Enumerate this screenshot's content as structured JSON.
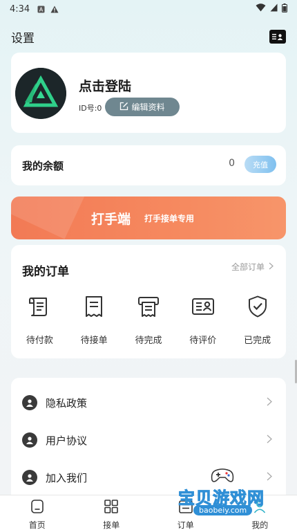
{
  "status_bar": {
    "time": "4:34"
  },
  "header": {
    "title": "设置",
    "icon": "contact-card-icon"
  },
  "profile": {
    "login_title": "点击登陆",
    "id_label": "ID号:0",
    "edit_label": "编辑资料"
  },
  "balance": {
    "label": "我的余额",
    "value": "0",
    "recharge_label": "充值"
  },
  "banner": {
    "title": "打手端",
    "subtitle": "打手接单专用"
  },
  "orders": {
    "title": "我的订单",
    "all_label": "全部订单",
    "items": [
      {
        "label": "待付款",
        "icon": "payment-doc-icon"
      },
      {
        "label": "待接单",
        "icon": "receipt-icon"
      },
      {
        "label": "待完成",
        "icon": "printer-icon"
      },
      {
        "label": "待评价",
        "icon": "review-card-icon"
      },
      {
        "label": "已完成",
        "icon": "shield-check-icon"
      }
    ]
  },
  "menu": {
    "items": [
      {
        "label": "隐私政策",
        "icon": "user-icon"
      },
      {
        "label": "用户协议",
        "icon": "user-icon"
      },
      {
        "label": "加入我们",
        "icon": "user-icon"
      }
    ]
  },
  "tabbar": {
    "items": [
      {
        "label": "首页",
        "icon": "home-icon"
      },
      {
        "label": "接单",
        "icon": "grid-icon"
      },
      {
        "label": "订单",
        "icon": "list-icon"
      },
      {
        "label": "我的",
        "icon": "profile-icon"
      }
    ]
  },
  "watermark": {
    "text": "宝贝游戏网",
    "url": "baobeiy.com"
  },
  "colors": {
    "banner": "#f27a55",
    "edit_button": "#6f8790",
    "recharge": "#7fc0ef"
  }
}
